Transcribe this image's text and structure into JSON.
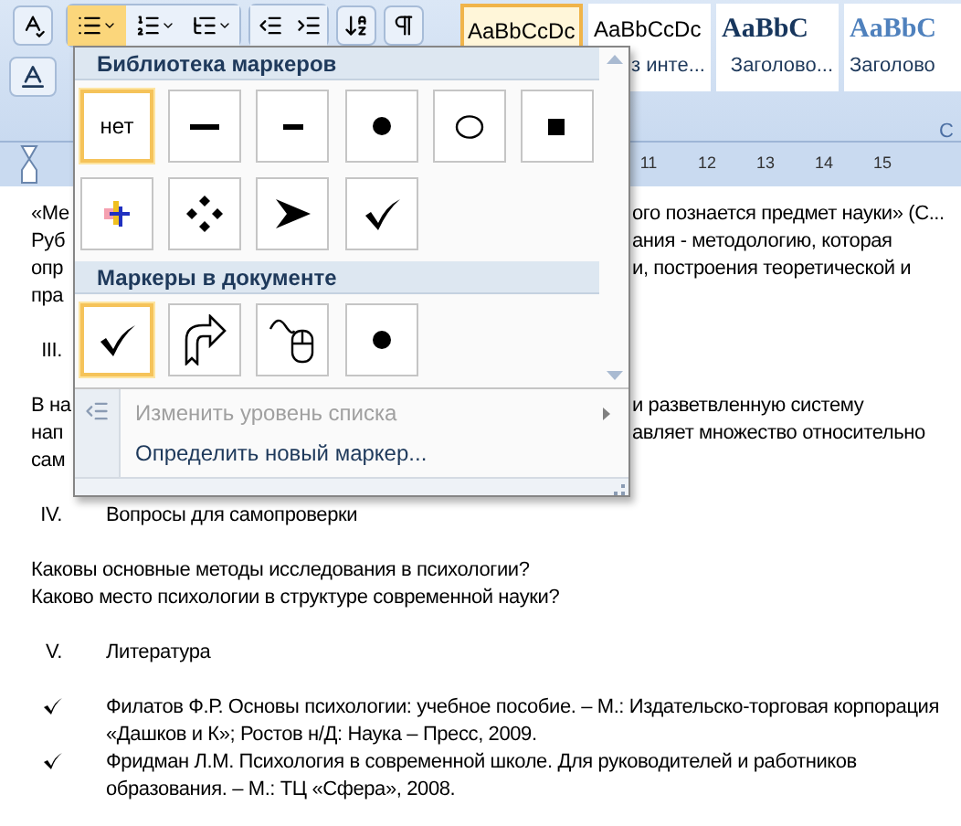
{
  "ribbon": {
    "bullets_button": {
      "pressed": true
    },
    "style_gallery": [
      {
        "sample": "AaBbCcDc",
        "kind": "normal",
        "selected": true
      },
      {
        "sample": "AaBbCcDc",
        "label": "з инте...",
        "kind": "normal",
        "selected": false
      },
      {
        "sample": "AaBbC",
        "label": "Заголово...",
        "kind": "heading1",
        "selected": false
      },
      {
        "sample": "AaBbC",
        "label": "Заголово",
        "kind": "heading2",
        "selected": false
      }
    ],
    "group_label": "С"
  },
  "ruler": {
    "ticks": [
      "11",
      "12",
      "13",
      "14",
      "15"
    ]
  },
  "document": [
    {
      "kind": "line",
      "left": "«Ме",
      "right": "ого познается предмет науки» (С..."
    },
    {
      "kind": "line",
      "left": "Руб",
      "right": "ания - методологию, которая"
    },
    {
      "kind": "line",
      "left": "опр",
      "right": "и, построения теоретической и"
    },
    {
      "kind": "line",
      "left": "пра"
    },
    {
      "kind": "gap"
    },
    {
      "kind": "heading",
      "number": "III."
    },
    {
      "kind": "gap"
    },
    {
      "kind": "line",
      "left": "В на",
      "right": "и разветвленную систему"
    },
    {
      "kind": "line",
      "left": "нап",
      "right": "авляет множество относительно"
    },
    {
      "kind": "line",
      "left": "сам"
    },
    {
      "kind": "gap"
    },
    {
      "kind": "heading",
      "number": "IV.",
      "text": "Вопросы для самопроверки"
    },
    {
      "kind": "gap"
    },
    {
      "kind": "line",
      "left": "Каковы основные методы исследования в психологии?"
    },
    {
      "kind": "line",
      "left": "Каково место психологии в структуре современной науки?"
    },
    {
      "kind": "gap"
    },
    {
      "kind": "heading",
      "number": "V.",
      "text": "Литература"
    },
    {
      "kind": "gap"
    },
    {
      "kind": "bullet",
      "text": "Филатов Ф.Р. Основы психологии: учебное пособие. – М.: Издательско-торговая корпорация «Дашков и К»; Ростов н/Д: Наука – Пресс, 2009."
    },
    {
      "kind": "bullet",
      "text": "Фридман Л.М. Психология в современной школе. Для руководителей и работников образования. – М.: ТЦ «Сфера», 2008."
    }
  ],
  "bullet_menu": {
    "sections": [
      {
        "title": "Библиотека маркеров",
        "items": [
          {
            "kind": "none",
            "text": "нет",
            "selected": true
          },
          {
            "kind": "long-dash",
            "selected": false
          },
          {
            "kind": "short-dash",
            "selected": false
          },
          {
            "kind": "dot",
            "selected": false
          },
          {
            "kind": "circle",
            "selected": false
          },
          {
            "kind": "square",
            "selected": false
          },
          {
            "kind": "color-cross",
            "selected": false
          },
          {
            "kind": "diamonds",
            "selected": false
          },
          {
            "kind": "arrowhead",
            "selected": false
          },
          {
            "kind": "check",
            "selected": false
          }
        ]
      },
      {
        "title": "Маркеры в документе",
        "items": [
          {
            "kind": "check",
            "selected": true
          },
          {
            "kind": "arrow-ribbon",
            "selected": false
          },
          {
            "kind": "mouse",
            "selected": false
          },
          {
            "kind": "dot",
            "selected": false
          }
        ]
      }
    ],
    "commands": [
      {
        "label": "Изменить уровень списка",
        "disabled": true,
        "submenu": true
      },
      {
        "label": "Определить новый маркер...",
        "disabled": false,
        "submenu": false
      }
    ]
  }
}
